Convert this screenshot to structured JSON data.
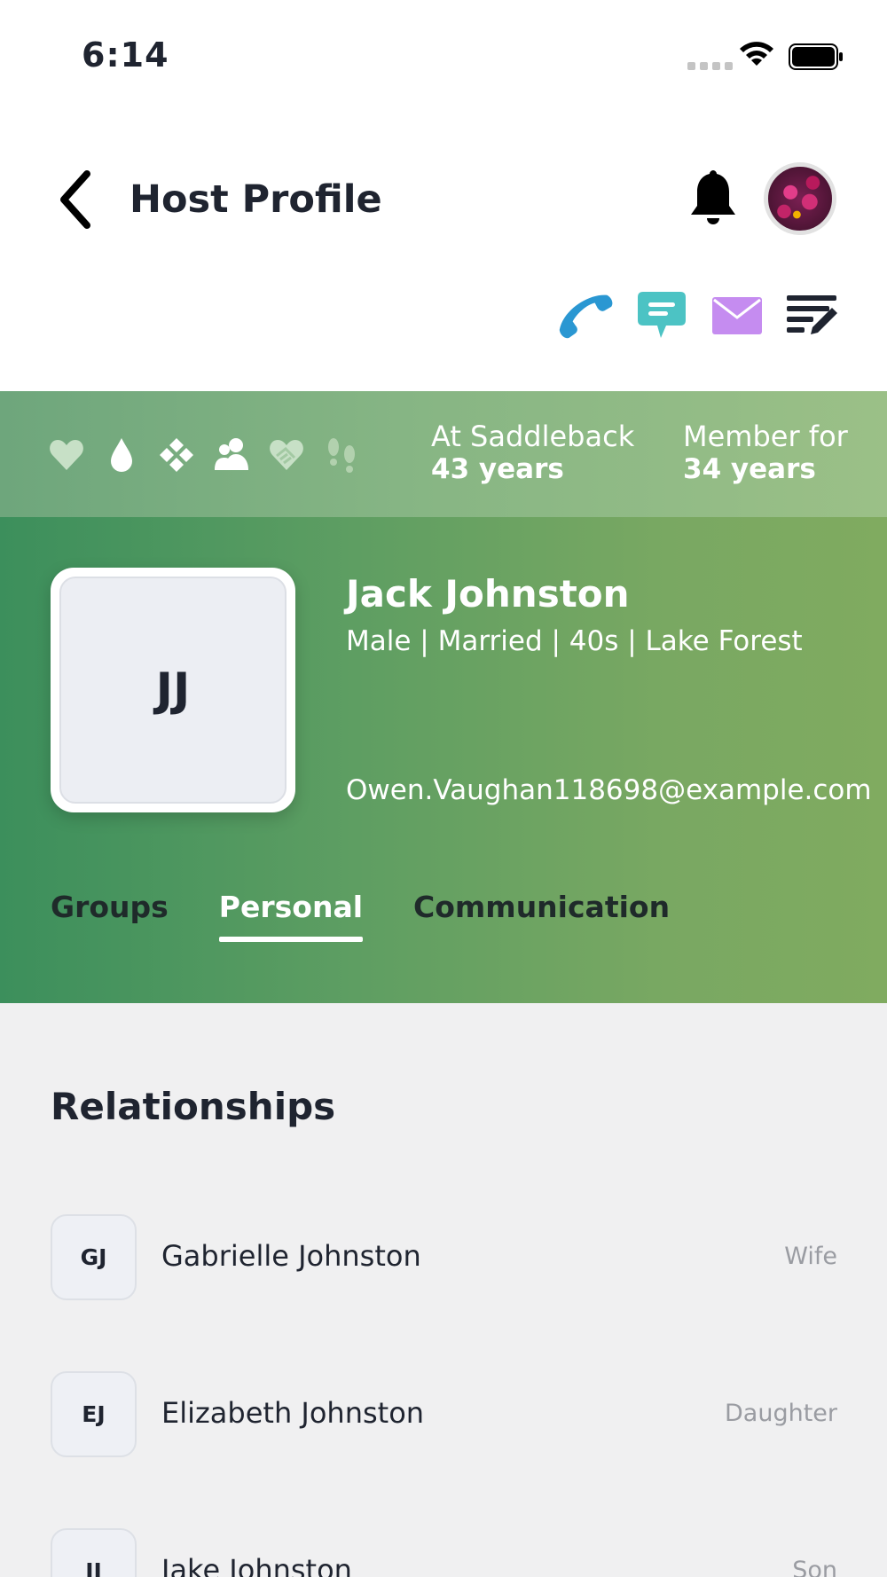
{
  "status_bar": {
    "time": "6:14"
  },
  "header": {
    "title": "Host Profile"
  },
  "actions": [
    {
      "name": "phone-icon",
      "color": "#2a97d2"
    },
    {
      "name": "chat-icon",
      "color": "#4cc3c4"
    },
    {
      "name": "mail-icon",
      "color": "#c58cf0"
    },
    {
      "name": "notes-icon",
      "color": "#1f2430"
    }
  ],
  "stats": {
    "badges": [
      "heart-icon",
      "drop-icon",
      "diamonds-icon",
      "people-icon",
      "handshake-heart-icon",
      "footprints-icon"
    ],
    "at_label": "At Saddleback",
    "at_value": "43 years",
    "member_label": "Member for",
    "member_value": "34 years"
  },
  "profile": {
    "initials": "JJ",
    "name": "Jack Johnston",
    "meta": "Male | Married | 40s | Lake Forest",
    "email": "Owen.Vaughan118698@example.com"
  },
  "tabs": [
    {
      "label": "Groups",
      "active": false
    },
    {
      "label": "Personal",
      "active": true
    },
    {
      "label": "Communication",
      "active": false
    }
  ],
  "relationships": {
    "title": "Relationships",
    "items": [
      {
        "initials": "GJ",
        "name": "Gabrielle Johnston",
        "type": "Wife"
      },
      {
        "initials": "EJ",
        "name": "Elizabeth Johnston",
        "type": "Daughter"
      },
      {
        "initials": "JJ",
        "name": "Jake Johnston",
        "type": "Son"
      }
    ]
  }
}
